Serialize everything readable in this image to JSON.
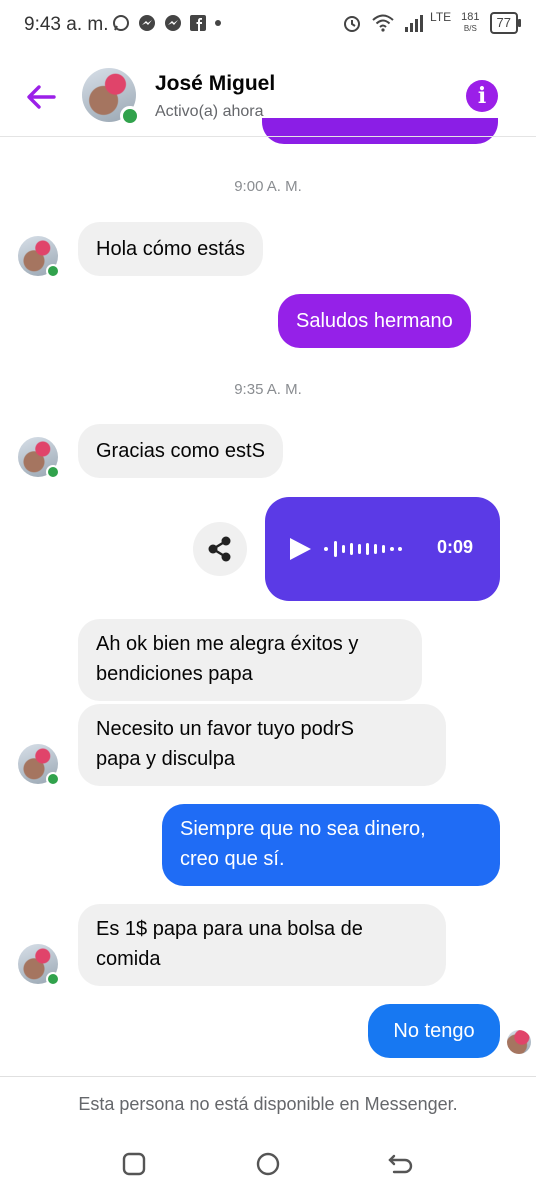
{
  "status_bar": {
    "time": "9:43 a. m.",
    "network": "LTE",
    "speed_value": "181",
    "speed_unit": "B/S",
    "battery": "77",
    "icons": [
      "whatsapp-icon",
      "messenger-icon",
      "messenger-icon",
      "facebook-icon",
      "dot-icon",
      "alarm-icon",
      "wifi-icon",
      "signal-icon"
    ]
  },
  "header": {
    "name": "José Miguel",
    "status": "Activo(a) ahora",
    "info_symbol": "i"
  },
  "messages": [
    {
      "type": "time",
      "text": "9:00 A. M."
    },
    {
      "type": "incoming",
      "text": "Hola cómo estás"
    },
    {
      "type": "outgoing",
      "text": "Saludos hermano"
    },
    {
      "type": "time",
      "text": "9:35 A. M."
    },
    {
      "type": "incoming",
      "text": "Gracias como estS"
    },
    {
      "type": "audio",
      "duration": "0:09"
    },
    {
      "type": "incoming",
      "lines": [
        "Ah ok bien me alegra éxitos y",
        "bendiciones papa"
      ]
    },
    {
      "type": "incoming",
      "lines": [
        "Necesito un favor tuyo podrS",
        "papa y disculpa"
      ]
    },
    {
      "type": "outgoing",
      "lines": [
        "Siempre que no sea dinero,",
        "creo que sí."
      ]
    },
    {
      "type": "incoming",
      "lines": [
        "Es 1$ papa para una bolsa de",
        "comida"
      ]
    },
    {
      "type": "outgoing",
      "text": "No tengo"
    }
  ],
  "footer": {
    "notice": "Esta persona no está disponible en Messenger."
  },
  "colors": {
    "accent_purple": "#9b1fe8",
    "bubble_purple": "#9521e8",
    "audio_bubble": "#5b3ae6",
    "bubble_blue": "#1f6cf5",
    "incoming_bubble": "#f0f0f0",
    "online_green": "#31a24c"
  }
}
